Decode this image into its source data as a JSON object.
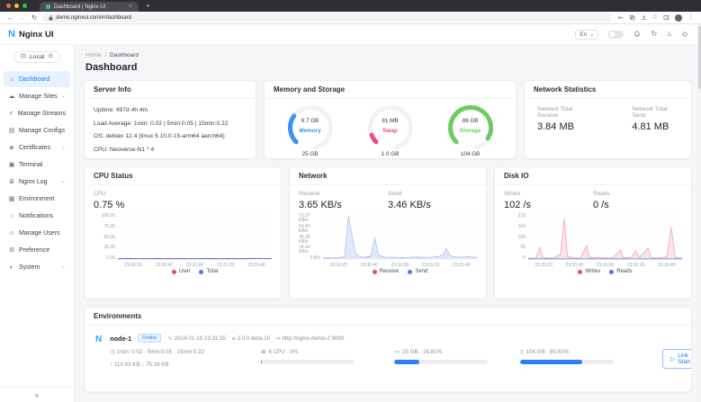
{
  "browser": {
    "tab_title": "Dashboard | Nginx UI",
    "url": "demo.nginxui.com/#/dashboard"
  },
  "app_header": {
    "brand_letter": "N",
    "brand": "Nginx UI",
    "language": "En"
  },
  "icons": {
    "dashboard-icon": "⌂",
    "manage-sites-icon": "☁",
    "manage-streams-icon": "<",
    "manage-configs-icon": "▤",
    "certificates-icon": "◈",
    "terminal-icon": "▣",
    "nginx-log-icon": "≣",
    "environment-icon": "▦",
    "notifications-icon": "○",
    "manage-users-icon": "☺",
    "preference-icon": "⚙",
    "system-icon": "◐",
    "chevron-down": "⌄",
    "collapse-icon": "«",
    "env-selector-icon": "▤",
    "gear-icon": "⚙",
    "pulse-icon": "∿",
    "version-icon": "⌀",
    "link-icon": "∞",
    "load-avg-icon": "◷",
    "cpu-icon": "⊞",
    "memory-icon": "▭",
    "storage-icon": "▯",
    "arrow-up": "↑",
    "arrow-down": "↓",
    "play-icon": "▷",
    "back-icon": "←",
    "forward-icon": "→",
    "reload-icon": "↻",
    "restart-icon": "↻",
    "home-icon": "⌂",
    "star-icon": "☆",
    "menu-dots-icon": "⋮",
    "new-tab-icon": "+",
    "close-icon": "×"
  },
  "sidebar": {
    "env_selector": "Local",
    "items": [
      {
        "label": "Dashboard",
        "icon": "dashboard-icon",
        "active": true,
        "expandable": false
      },
      {
        "label": "Manage Sites",
        "icon": "manage-sites-icon",
        "active": false,
        "expandable": true
      },
      {
        "label": "Manage Streams",
        "icon": "manage-streams-icon",
        "active": false,
        "expandable": false
      },
      {
        "label": "Manage Configs",
        "icon": "manage-configs-icon",
        "active": false,
        "expandable": false
      },
      {
        "label": "Certificates",
        "icon": "certificates-icon",
        "active": false,
        "expandable": true
      },
      {
        "label": "Terminal",
        "icon": "terminal-icon",
        "active": false,
        "expandable": false
      },
      {
        "label": "Nginx Log",
        "icon": "nginx-log-icon",
        "active": false,
        "expandable": true
      },
      {
        "label": "Environment",
        "icon": "environment-icon",
        "active": false,
        "expandable": false
      },
      {
        "label": "Notifications",
        "icon": "notifications-icon",
        "active": false,
        "expandable": false
      },
      {
        "label": "Manage Users",
        "icon": "manage-users-icon",
        "active": false,
        "expandable": false
      },
      {
        "label": "Preference",
        "icon": "preference-icon",
        "active": false,
        "expandable": false
      },
      {
        "label": "System",
        "icon": "system-icon",
        "active": false,
        "expandable": true
      }
    ]
  },
  "main": {
    "breadcrumb_home": "Home",
    "breadcrumb_sep": "/",
    "breadcrumb_current": "Dashboard",
    "page_title": "Dashboard"
  },
  "server_info": {
    "title": "Server Info",
    "lines": [
      "Uptime: 497d 4h 4m",
      "Load Average: 1min: 0.02 | 5min:0.05 | 15min:0.22",
      "OS: debian 12.4 (linux 5.10.0-15-arm64 aarch64)",
      "CPU: Neoverse-N1 * 4"
    ]
  },
  "memory_storage": {
    "title": "Memory and Storage",
    "gauges": [
      {
        "name": "memory",
        "value": "6.7 GB",
        "label": "Memory",
        "total": "25 GB",
        "percent": 26.8,
        "color": "#3e8ef7"
      },
      {
        "name": "swap",
        "value": "81 MB",
        "label": "Swap",
        "total": "1.0 GB",
        "percent": 8,
        "color": "#ee4e7f"
      },
      {
        "name": "storage",
        "value": "89 GB",
        "label": "Storage",
        "total": "104 GB",
        "percent": 85.6,
        "color": "#6ecb5f"
      }
    ]
  },
  "network_stats": {
    "title": "Network Statistics",
    "receive_label": "Network Total Receive",
    "receive_value": "3.84 MB",
    "send_label": "Network Total Send",
    "send_value": "4.81 MB"
  },
  "chart_data": [
    {
      "type": "line",
      "title": "CPU Status",
      "stats": [
        {
          "label": "CPU",
          "value": "0.75 %"
        }
      ],
      "ylim": [
        0,
        100
      ],
      "yticks": [
        "100.00",
        "75.00",
        "50.00",
        "25.00",
        "0.00"
      ],
      "xticks": [
        "23:30:20",
        "23:30:40",
        "23:31:00",
        "23:31:20",
        "23:31:40"
      ],
      "legend": [
        "User",
        "Total"
      ],
      "series": [
        {
          "name": "User",
          "color": "#ef4872",
          "dot": "#ef4872",
          "points": [
            [
              0,
              0.5
            ],
            [
              0.08,
              0.8
            ],
            [
              0.16,
              0.4
            ],
            [
              0.24,
              0.9
            ],
            [
              0.32,
              0.5
            ],
            [
              0.4,
              0.7
            ],
            [
              0.48,
              0.4
            ],
            [
              0.56,
              0.8
            ],
            [
              0.64,
              0.5
            ],
            [
              0.72,
              0.7
            ],
            [
              0.8,
              0.5
            ],
            [
              0.88,
              0.8
            ],
            [
              1,
              0.6
            ]
          ]
        },
        {
          "name": "Total",
          "color": "#4a7bf7",
          "dot": "#4a7bf7",
          "points": [
            [
              0,
              1.1
            ],
            [
              0.08,
              1.4
            ],
            [
              0.16,
              0.9
            ],
            [
              0.24,
              1.5
            ],
            [
              0.32,
              1.0
            ],
            [
              0.4,
              1.3
            ],
            [
              0.48,
              0.9
            ],
            [
              0.56,
              1.4
            ],
            [
              0.64,
              1.0
            ],
            [
              0.72,
              1.2
            ],
            [
              0.8,
              1.0
            ],
            [
              0.88,
              1.4
            ],
            [
              1,
              1.1
            ]
          ]
        }
      ]
    },
    {
      "type": "area",
      "title": "Network",
      "stats": [
        {
          "label": "Receive",
          "value": "3.65 KB/s"
        },
        {
          "label": "Send",
          "value": "3.46 KB/s"
        }
      ],
      "ylim": [
        0,
        72.57
      ],
      "yticks": [
        "72.57 KB/s",
        "54.43 KB/s",
        "36.28 KB/s",
        "18.14 KB/s",
        "0 B/s"
      ],
      "xticks": [
        "23:30:20",
        "23:30:40",
        "23:31:00",
        "23:31:20",
        "23:31:40"
      ],
      "legend": [
        "Receive",
        "Send"
      ],
      "series": [
        {
          "name": "Receive",
          "color": "#f3a0bd",
          "dot": "#ef4872",
          "points": [
            [
              0,
              2
            ],
            [
              0.06,
              1.5
            ],
            [
              0.12,
              2.5
            ],
            [
              0.16,
              5
            ],
            [
              0.2,
              2
            ],
            [
              0.27,
              2.5
            ],
            [
              0.33,
              7
            ],
            [
              0.37,
              2
            ],
            [
              0.45,
              2.5
            ],
            [
              0.53,
              2
            ],
            [
              0.6,
              3
            ],
            [
              0.68,
              2
            ],
            [
              0.75,
              3.5
            ],
            [
              0.8,
              2.5
            ],
            [
              0.88,
              3
            ],
            [
              0.95,
              2
            ],
            [
              1,
              2.5
            ]
          ]
        },
        {
          "name": "Send",
          "color": "#a9bce8",
          "dot": "#4a7bf7",
          "fill": "#e1e8f7",
          "points": [
            [
              0,
              1.5
            ],
            [
              0.06,
              1
            ],
            [
              0.1,
              2
            ],
            [
              0.14,
              4
            ],
            [
              0.165,
              72
            ],
            [
              0.19,
              38
            ],
            [
              0.21,
              10
            ],
            [
              0.24,
              4
            ],
            [
              0.28,
              2.5
            ],
            [
              0.31,
              4
            ],
            [
              0.335,
              36
            ],
            [
              0.36,
              7
            ],
            [
              0.4,
              2.5
            ],
            [
              0.46,
              3
            ],
            [
              0.52,
              2
            ],
            [
              0.58,
              3
            ],
            [
              0.64,
              2.5
            ],
            [
              0.7,
              3
            ],
            [
              0.75,
              4
            ],
            [
              0.78,
              7
            ],
            [
              0.8,
              18
            ],
            [
              0.83,
              5
            ],
            [
              0.88,
              3
            ],
            [
              0.93,
              4
            ],
            [
              1,
              2.5
            ]
          ]
        }
      ]
    },
    {
      "type": "line",
      "title": "Disk IO",
      "stats": [
        {
          "label": "Writes",
          "value": "102 /s"
        },
        {
          "label": "Reads",
          "value": "0 /s"
        }
      ],
      "ylim": [
        0,
        218
      ],
      "yticks": [
        "218",
        "164",
        "109",
        "55",
        "0"
      ],
      "xticks": [
        "23:30:20",
        "23:30:40",
        "23:31:00",
        "23:31:20",
        "23:31:40"
      ],
      "legend": [
        "Writes",
        "Reads"
      ],
      "series": [
        {
          "name": "Writes",
          "color": "#f598b0",
          "dot": "#ef4872",
          "fill": "#fbe3ea",
          "points": [
            [
              0,
              3
            ],
            [
              0.05,
              5
            ],
            [
              0.075,
              58
            ],
            [
              0.095,
              6
            ],
            [
              0.13,
              4
            ],
            [
              0.17,
              7
            ],
            [
              0.21,
              25
            ],
            [
              0.235,
              205
            ],
            [
              0.255,
              12
            ],
            [
              0.3,
              5
            ],
            [
              0.34,
              7
            ],
            [
              0.38,
              68
            ],
            [
              0.4,
              6
            ],
            [
              0.45,
              9
            ],
            [
              0.5,
              5
            ],
            [
              0.55,
              7
            ],
            [
              0.6,
              45
            ],
            [
              0.62,
              6
            ],
            [
              0.67,
              9
            ],
            [
              0.7,
              42
            ],
            [
              0.72,
              7
            ],
            [
              0.78,
              55
            ],
            [
              0.8,
              7
            ],
            [
              0.85,
              5
            ],
            [
              0.9,
              12
            ],
            [
              0.93,
              160
            ],
            [
              0.955,
              9
            ],
            [
              1,
              5
            ]
          ]
        },
        {
          "name": "Reads",
          "color": "#4a7bf7",
          "dot": "#4a7bf7",
          "points": [
            [
              0,
              0.5
            ],
            [
              0.5,
              0.5
            ],
            [
              1,
              0.5
            ]
          ]
        }
      ]
    }
  ],
  "environments": {
    "title": "Environments",
    "node": {
      "logo": "N",
      "name": "node-1",
      "status": "Online",
      "checked_at": "2024-01-15 23:31:55",
      "version": "2.0.0-beta.10",
      "url": "http://nginx-demo-2:9000",
      "load": "1min: 0.02 · 5min:0.05 · 15min:0.22",
      "traffic_up": "110.63 KB",
      "traffic_down": "75.16 KB",
      "cpu_text": "4 CPU · 0%",
      "cpu_bar_percent": 1,
      "memory_text": "25 GB · 26.82%",
      "memory_bar_percent": 26.82,
      "storage_text": "104 GB · 85.63%",
      "storage_bar_percent": 66,
      "action_label": "Link Start"
    }
  }
}
